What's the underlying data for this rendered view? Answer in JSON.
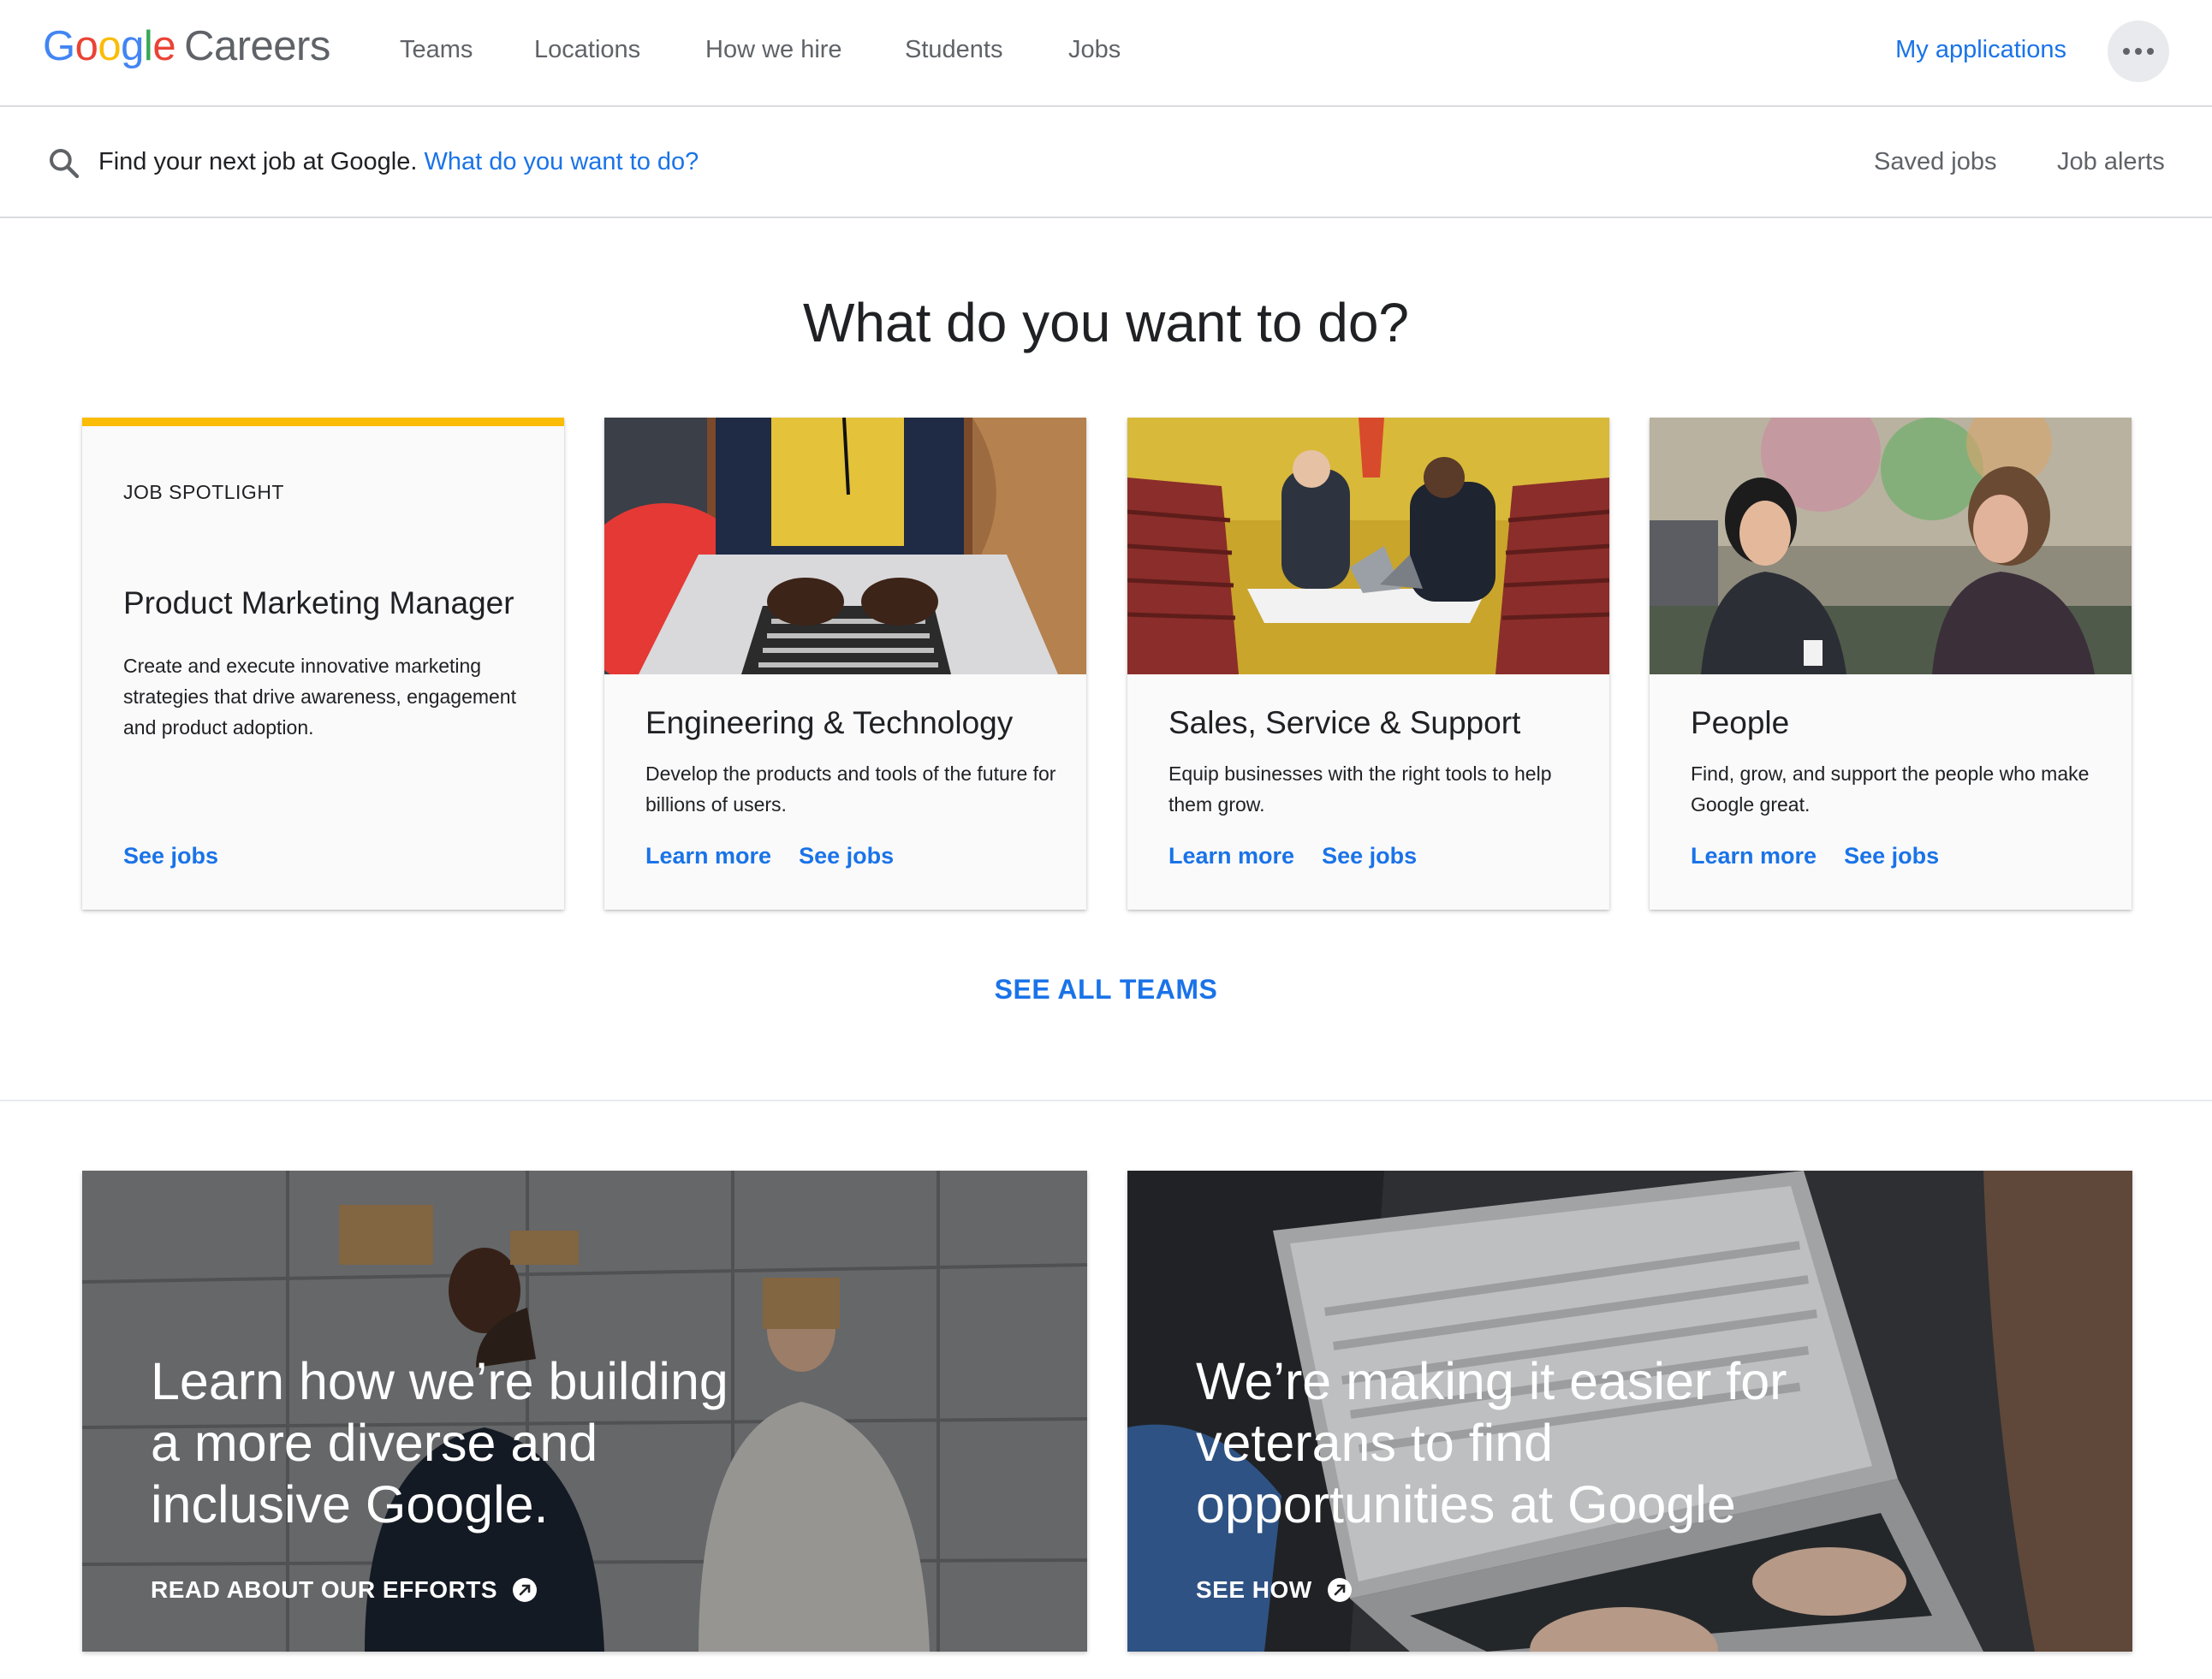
{
  "header": {
    "logo_google_letters": [
      "G",
      "o",
      "o",
      "g",
      "l",
      "e"
    ],
    "logo_product": "Careers",
    "nav": [
      "Teams",
      "Locations",
      "How we hire",
      "Students",
      "Jobs"
    ],
    "my_applications": "My applications",
    "more_icon": "more-horiz-icon"
  },
  "search": {
    "icon": "search-icon",
    "lead": "Find your next job at Google.",
    "prompt": "What do you want to do?",
    "saved_jobs": "Saved jobs",
    "job_alerts": "Job alerts"
  },
  "main": {
    "title": "What do you want to do?",
    "spotlight": {
      "eyebrow": "JOB SPOTLIGHT",
      "title": "Product Marketing Manager",
      "description": "Create and execute innovative marketing strategies that drive awareness, engagement and product adoption.",
      "see_jobs": "See jobs"
    },
    "cards": [
      {
        "title": "Engineering & Technology",
        "description": "Develop the products and tools of the future for billions of users.",
        "learn_more": "Learn more",
        "see_jobs": "See jobs"
      },
      {
        "title": "Sales, Service & Support",
        "description": "Equip businesses with the right tools to help them grow.",
        "learn_more": "Learn more",
        "see_jobs": "See jobs"
      },
      {
        "title": "People",
        "description": "Find, grow, and support the people who make Google great.",
        "learn_more": "Learn more",
        "see_jobs": "See jobs"
      }
    ],
    "see_all_teams": "SEE ALL TEAMS"
  },
  "banners": [
    {
      "headline": "Learn how we’re building a more diverse and inclusive Google.",
      "cta": "READ ABOUT OUR EFFORTS",
      "cta_icon": "arrow-circle-icon"
    },
    {
      "headline": "We’re making it easier for veterans to find opportunities at Google",
      "cta": "SEE HOW",
      "cta_icon": "arrow-circle-icon"
    }
  ],
  "colors": {
    "link_blue": "#1a73e8",
    "spotlight_accent": "#fbbc04",
    "text": "#202124",
    "muted": "#5f6368"
  }
}
